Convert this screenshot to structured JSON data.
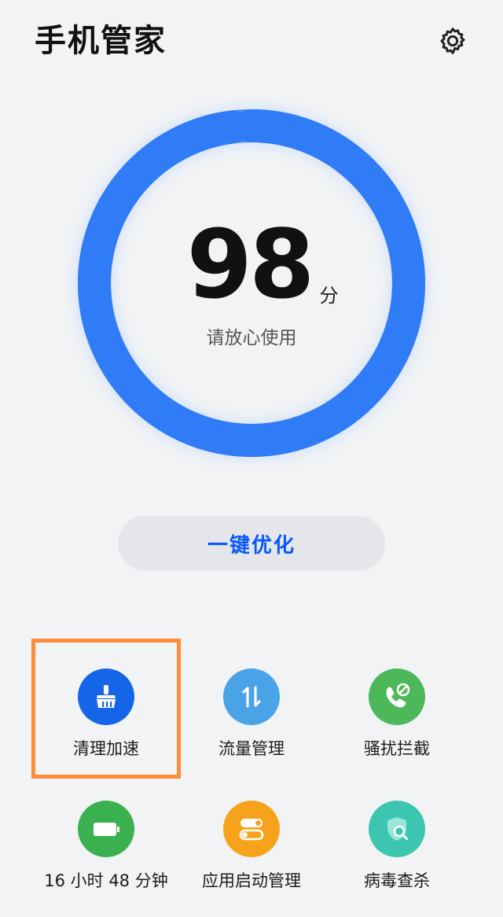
{
  "header": {
    "title": "手机管家",
    "settings_icon": "gear-icon"
  },
  "score": {
    "value": "98",
    "unit": "分",
    "status": "请放心使用",
    "level": 0.98,
    "ring_color_start": "#2f7cf6",
    "ring_color_end": "#4a8ff0"
  },
  "optimize_button": {
    "label": "一键优化",
    "color": "#0a59f7"
  },
  "features": [
    {
      "label": "清理加速",
      "icon": "broom-icon",
      "color": "#1565e8"
    },
    {
      "label": "流量管理",
      "icon": "data-transfer-icon",
      "color": "#4aa3e6"
    },
    {
      "label": "骚扰拦截",
      "icon": "phone-block-icon",
      "color": "#4cb85a"
    },
    {
      "label": "16 小时 48 分钟",
      "icon": "battery-icon",
      "color": "#3ab04e"
    },
    {
      "label": "应用启动管理",
      "icon": "toggle-switch-icon",
      "color": "#f7a21b"
    },
    {
      "label": "病毒查杀",
      "icon": "shield-search-icon",
      "color": "#3cc6b0"
    }
  ]
}
